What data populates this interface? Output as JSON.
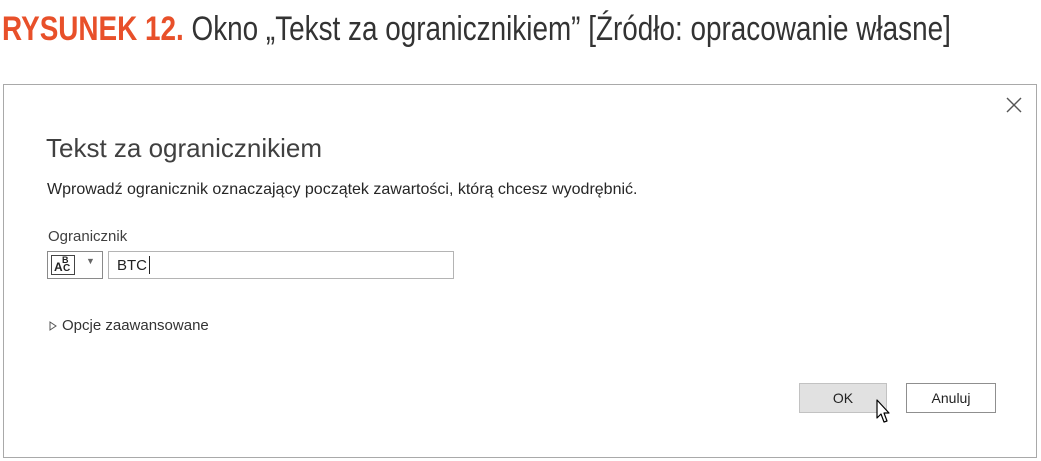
{
  "caption": {
    "label": "RYSUNEK 12.",
    "text": "Okno „Tekst za ogranicznikiem” [Źródło: opracowanie własne]"
  },
  "dialog": {
    "title": "Tekst za ogranicznikiem",
    "description": "Wprowadź ogranicznik oznaczający początek zawartości, którą chcesz wyodrębnić.",
    "field_label": "Ogranicznik",
    "type_selector": {
      "icon": "abc-text-type-icon",
      "A": "A",
      "B": "B",
      "C": "C"
    },
    "input_value": "BTC",
    "advanced_label": "Opcje zaawansowane",
    "ok_label": "OK",
    "cancel_label": "Anuluj",
    "accent": "#e8502a"
  }
}
